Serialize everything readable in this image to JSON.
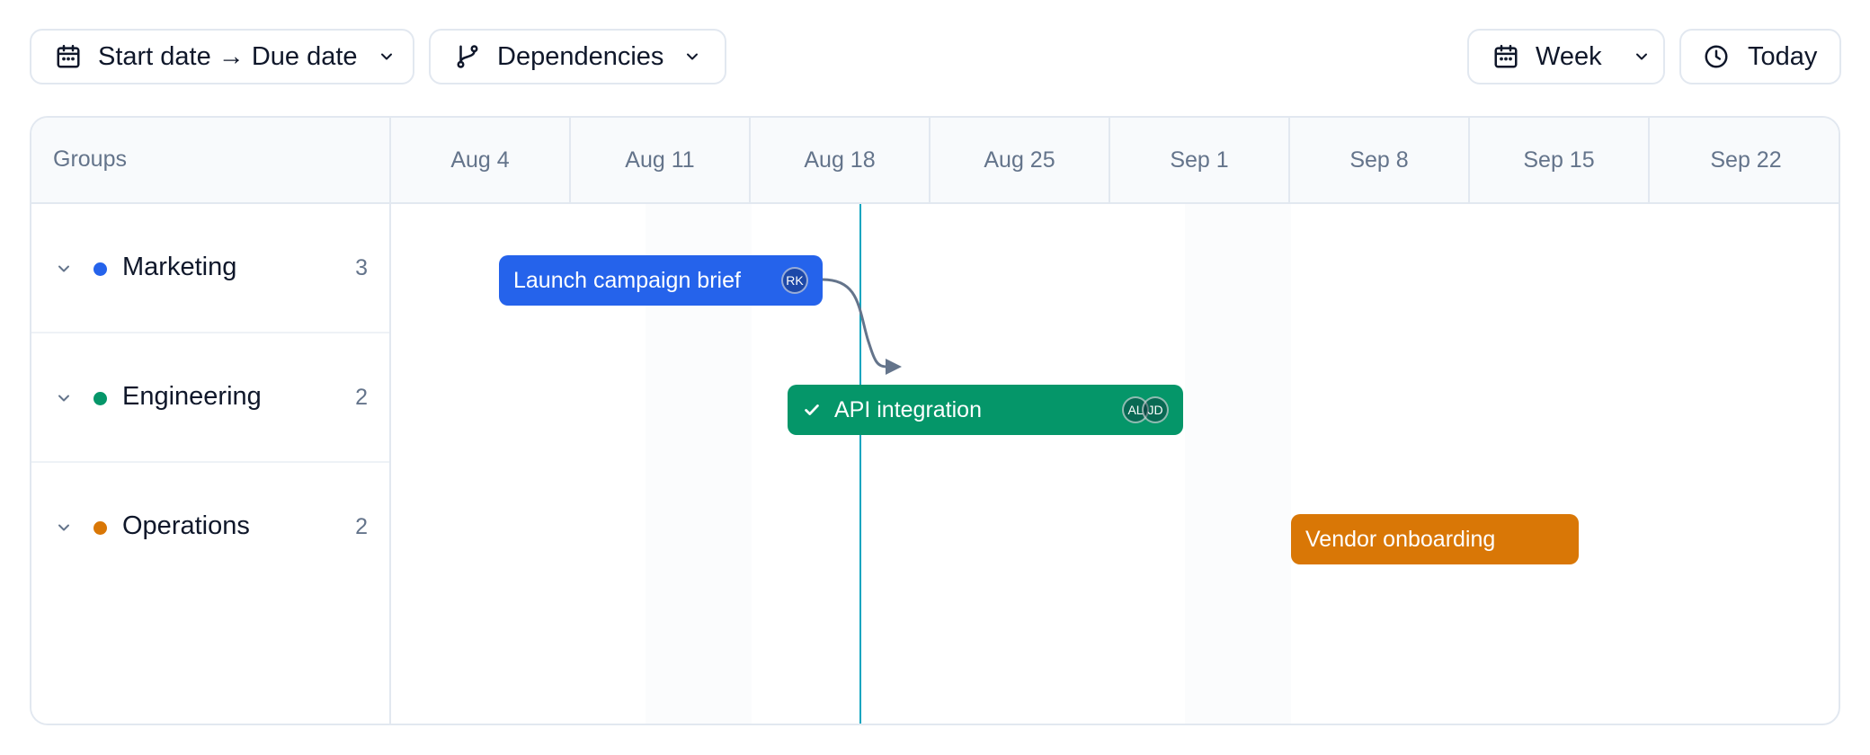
{
  "toolbar": {
    "date_range_label": "Start date → Due date",
    "dependencies_label": "Dependencies",
    "zoom_label": "Week",
    "today_label": "Today"
  },
  "gantt": {
    "groups_header": "Groups",
    "weeks": [
      "Aug 4",
      "Aug 11",
      "Aug 18",
      "Aug 25",
      "Sep 1",
      "Sep 8",
      "Sep 15",
      "Sep 22"
    ],
    "groups": [
      {
        "name": "Marketing",
        "count": "3",
        "color": "#2563eb"
      },
      {
        "name": "Engineering",
        "count": "2",
        "color": "#059669"
      },
      {
        "name": "Operations",
        "count": "2",
        "color": "#d97706"
      }
    ],
    "tasks": [
      {
        "label": "Launch campaign brief",
        "group": "Marketing",
        "color": "#2563eb",
        "completed": false,
        "assignees": [
          "RK"
        ]
      },
      {
        "label": "API integration",
        "group": "Engineering",
        "color": "#059669",
        "completed": true,
        "assignees": [
          "AL",
          "JD"
        ]
      },
      {
        "label": "Vendor onboarding",
        "group": "Operations",
        "color": "#d97706",
        "completed": false,
        "assignees": []
      }
    ],
    "dependency": {
      "from": "Launch campaign brief",
      "to": "API integration"
    },
    "colors": {
      "today_line": "#0ea5c0",
      "dependency_arrow": "#64748b"
    }
  }
}
